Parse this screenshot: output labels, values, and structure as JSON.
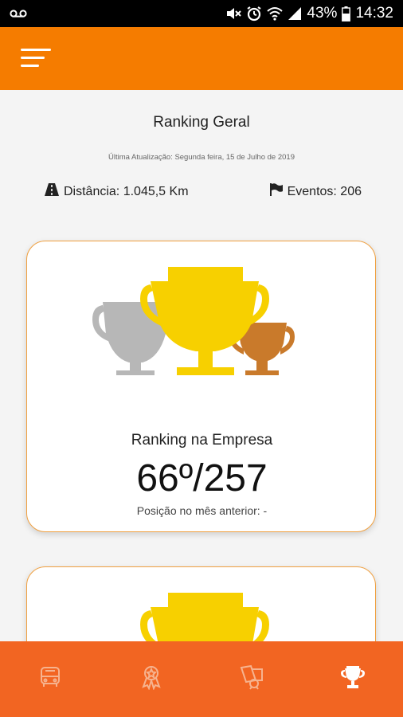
{
  "status_bar": {
    "battery": "43%",
    "time": "14:32",
    "icons": [
      "voicemail-icon",
      "mute-icon",
      "alarm-icon",
      "wifi-icon",
      "signal-icon",
      "battery-icon"
    ]
  },
  "app_bar": {
    "menu_icon": "menu-icon"
  },
  "header": {
    "title": "Ranking Geral",
    "last_update": "Última Atualização: Segunda feira, 15 de Julho de 2019",
    "distance": "Distância: 1.045,5 Km",
    "events": "Eventos: 206"
  },
  "ranking_card": {
    "label": "Ranking na Empresa",
    "value": "66º/257",
    "previous": "Posição no mês anterior: -"
  },
  "colors": {
    "accent": "#f57c00",
    "nav": "#f26522",
    "gold": "#f7d000",
    "silver": "#b7b7b7",
    "bronze": "#c97a2b"
  },
  "bottom_nav": {
    "items": [
      {
        "icon": "bus-icon",
        "active": false
      },
      {
        "icon": "medal-icon",
        "active": false
      },
      {
        "icon": "badges-icon",
        "active": false
      },
      {
        "icon": "trophy-icon",
        "active": true
      }
    ]
  }
}
